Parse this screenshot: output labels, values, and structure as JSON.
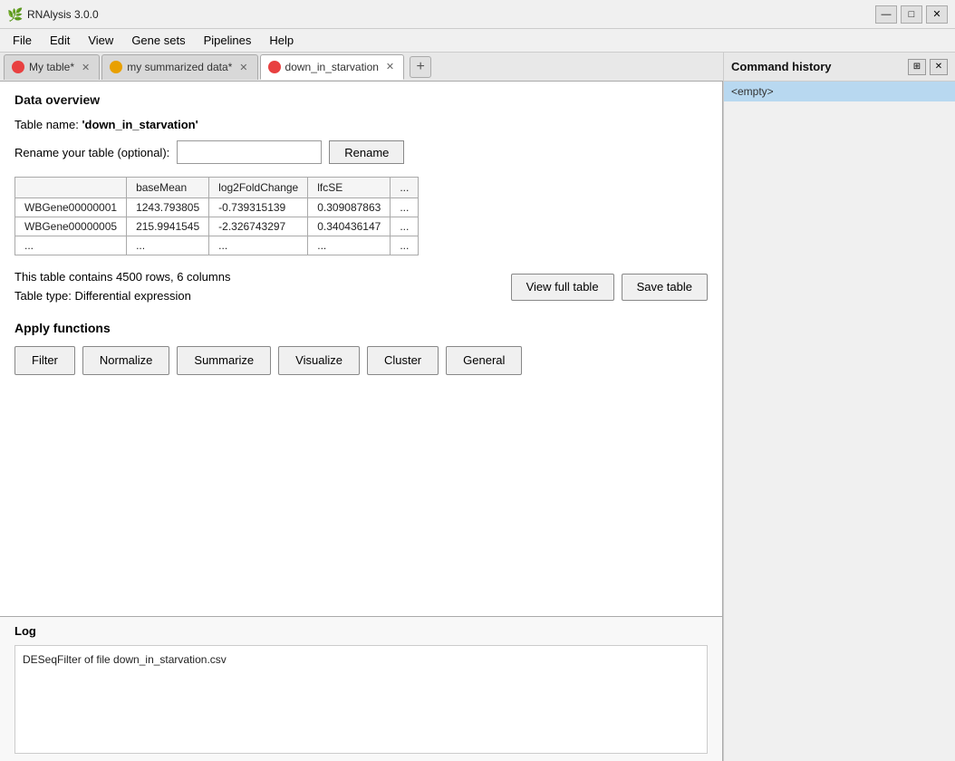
{
  "app": {
    "title": "RNAlysis 3.0.0",
    "icon": "🌿"
  },
  "titlebar": {
    "minimize": "—",
    "maximize": "□",
    "close": "✕"
  },
  "menu": {
    "items": [
      "File",
      "Edit",
      "View",
      "Gene sets",
      "Pipelines",
      "Help"
    ]
  },
  "tabs": [
    {
      "id": "tab1",
      "label": "My table*",
      "icon_color": "#e84040",
      "active": false
    },
    {
      "id": "tab2",
      "label": "my summarized data*",
      "icon_color": "#e8a000",
      "active": false
    },
    {
      "id": "tab3",
      "label": "down_in_starvation",
      "icon_color": "#e84040",
      "active": true
    }
  ],
  "tab_add_label": "+",
  "data_overview": {
    "section_title": "Data overview",
    "table_name_label": "Table name:",
    "table_name_value": "'down_in_starvation'",
    "rename_label": "Rename your table (optional):",
    "rename_placeholder": "",
    "rename_btn": "Rename",
    "table": {
      "columns": [
        "",
        "baseMean",
        "log2FoldChange",
        "lfcSE",
        "..."
      ],
      "rows": [
        [
          "WBGene00000001",
          "1243.793805",
          "-0.739315139",
          "0.309087863",
          "..."
        ],
        [
          "WBGene00000005",
          "215.9941545",
          "-2.326743297",
          "0.340436147",
          "..."
        ],
        [
          "...",
          "...",
          "...",
          "...",
          "..."
        ]
      ]
    },
    "table_info_line1": "This table contains 4500 rows, 6 columns",
    "table_info_line2": "Table type: Differential expression",
    "view_full_table_btn": "View full table",
    "save_table_btn": "Save table"
  },
  "apply_functions": {
    "section_title": "Apply functions",
    "buttons": [
      "Filter",
      "Normalize",
      "Summarize",
      "Visualize",
      "Cluster",
      "General"
    ]
  },
  "log": {
    "title": "Log",
    "content": "DESeqFilter of file down_in_starvation.csv"
  },
  "command_history": {
    "title": "Command history",
    "items": [
      "<empty>"
    ]
  }
}
